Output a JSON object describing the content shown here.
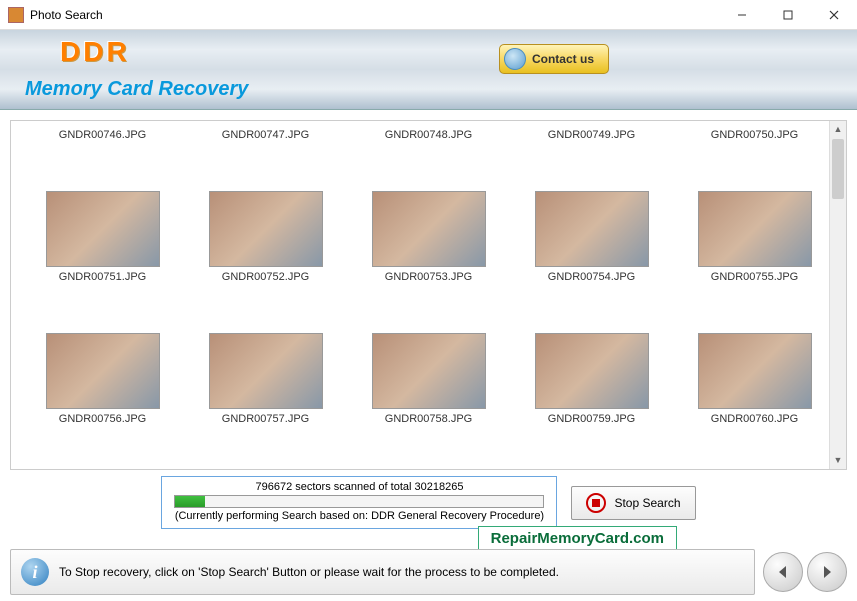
{
  "window": {
    "title": "Photo Search"
  },
  "header": {
    "logo": "DDR",
    "subtitle": "Memory Card Recovery",
    "contact_label": "Contact us"
  },
  "thumbs_top": [
    {
      "label": "GNDR00746.JPG"
    },
    {
      "label": "GNDR00747.JPG"
    },
    {
      "label": "GNDR00748.JPG"
    },
    {
      "label": "GNDR00749.JPG"
    },
    {
      "label": "GNDR00750.JPG"
    }
  ],
  "thumbs_mid": [
    {
      "label": "GNDR00751.JPG"
    },
    {
      "label": "GNDR00752.JPG"
    },
    {
      "label": "GNDR00753.JPG"
    },
    {
      "label": "GNDR00754.JPG"
    },
    {
      "label": "GNDR00755.JPG"
    }
  ],
  "thumbs_bot": [
    {
      "label": "GNDR00756.JPG"
    },
    {
      "label": "GNDR00757.JPG"
    },
    {
      "label": "GNDR00758.JPG"
    },
    {
      "label": "GNDR00759.JPG"
    },
    {
      "label": "GNDR00760.JPG"
    }
  ],
  "progress": {
    "text": "796672 sectors scanned of total 30218265",
    "sub": "(Currently performing Search based on:  DDR General Recovery Procedure)",
    "stop_label": "Stop Search"
  },
  "footer": {
    "info": "To Stop recovery, click on 'Stop Search' Button or please wait for the process to be completed.",
    "site": "RepairMemoryCard.com"
  }
}
